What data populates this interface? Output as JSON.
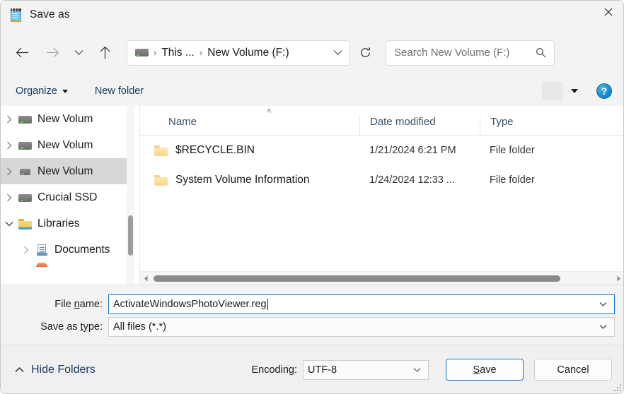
{
  "window": {
    "title": "Save as",
    "app_icon": "notepad-icon",
    "close_label": "×"
  },
  "nav": {
    "back_icon": "arrow-left-icon",
    "forward_icon": "arrow-right-icon",
    "recent_icon": "chevron-down-icon",
    "up_icon": "arrow-up-icon",
    "refresh_icon": "refresh-icon",
    "address_dropdown_icon": "chevron-down-icon",
    "breadcrumbs": [
      {
        "label": "",
        "icon": "drive-icon"
      },
      {
        "label": "This ...",
        "icon": ""
      },
      {
        "label": "New Volume (F:)",
        "icon": ""
      }
    ],
    "separator": "›"
  },
  "search": {
    "placeholder": "Search New Volume (F:)",
    "value": "",
    "icon": "search-icon"
  },
  "toolbar": {
    "organize_label": "Organize",
    "new_folder_label": "New folder",
    "view_icon": "list-view-icon",
    "view_caret_icon": "chevron-down-icon",
    "help_label": "?",
    "help_icon": "help-icon"
  },
  "sidebar": {
    "items": [
      {
        "label": "New Volum",
        "icon": "drive-icon",
        "expander": "›",
        "selected": false,
        "truncated": true
      },
      {
        "label": "New Volum",
        "icon": "drive-icon",
        "expander": "›",
        "selected": false,
        "truncated": true
      },
      {
        "label": "New Volum",
        "icon": "drive-icon-small",
        "expander": "›",
        "selected": true,
        "truncated": true
      },
      {
        "label": "Crucial SSD",
        "icon": "drive-icon",
        "expander": "›",
        "selected": false,
        "truncated": true
      },
      {
        "label": "Libraries",
        "icon": "folder-icon",
        "expander": "⌄",
        "selected": false,
        "truncated": false
      },
      {
        "label": "Documents",
        "icon": "documents-library-icon",
        "expander": "›",
        "selected": false,
        "truncated": true
      },
      {
        "label": "",
        "icon": "partial-icon",
        "expander": "",
        "selected": false,
        "truncated": true
      }
    ],
    "scrollbar": "vertical-scrollbar"
  },
  "filelist": {
    "sort_indicator": "˄",
    "columns": [
      "Name",
      "Date modified",
      "Type"
    ],
    "rows": [
      {
        "name": "$RECYCLE.BIN",
        "date_modified": "1/21/2024 6:21 PM",
        "type": "File folder",
        "icon": "folder-icon"
      },
      {
        "name": "System Volume Information",
        "date_modified": "1/24/2024 12:33 ...",
        "type": "File folder",
        "icon": "folder-icon"
      }
    ],
    "hscroll_left_icon": "triangle-left-icon",
    "hscroll_right_icon": "triangle-right-icon"
  },
  "form": {
    "file_name": {
      "label_pre": "File ",
      "label_acc": "n",
      "label_post": "ame:",
      "value": "ActivateWindowsPhotoViewer.reg",
      "dropdown_icon": "chevron-down-icon"
    },
    "save_as_type": {
      "label_pre": "Save as ",
      "label_acc": "t",
      "label_post": "ype:",
      "value": "All files  (*.*)",
      "dropdown_icon": "chevron-down-icon"
    }
  },
  "footer": {
    "hide_folders_label": "Hide Folders",
    "hide_folders_icon": "chevron-up-icon",
    "encoding_label": "Encoding:",
    "encoding_value": "UTF-8",
    "encoding_dropdown_icon": "chevron-down-icon",
    "save_pre": "",
    "save_acc": "S",
    "save_post": "ave",
    "save_label": "Save",
    "cancel_label": "Cancel",
    "resize_grip": "resize-grip-icon"
  },
  "colors": {
    "accent": "#1776c4",
    "chrome": "#f3f3f3",
    "footer": "#f0f0f0",
    "link_text": "#17375e",
    "selection": "#d7d7d7"
  }
}
